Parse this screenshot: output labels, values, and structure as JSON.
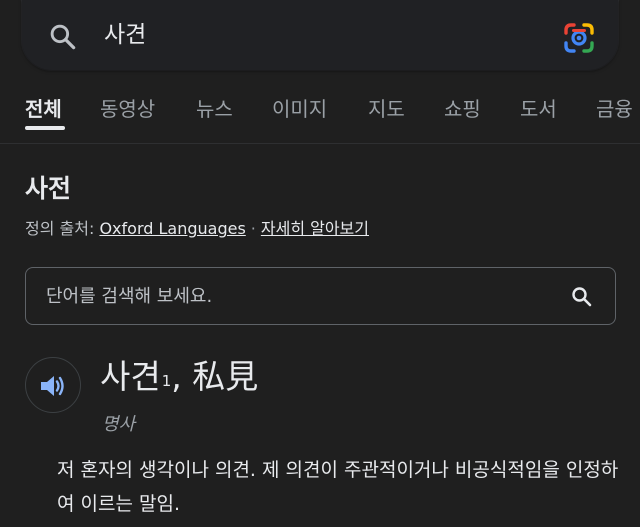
{
  "search": {
    "query": "사견"
  },
  "tabs": [
    {
      "label": "전체",
      "active": true
    },
    {
      "label": "동영상",
      "active": false
    },
    {
      "label": "뉴스",
      "active": false
    },
    {
      "label": "이미지",
      "active": false
    },
    {
      "label": "지도",
      "active": false
    },
    {
      "label": "쇼핑",
      "active": false
    },
    {
      "label": "도서",
      "active": false
    },
    {
      "label": "금융",
      "active": false
    }
  ],
  "dictionary": {
    "title": "사전",
    "source_prefix": "정의 출처:",
    "source_name": "Oxford Languages",
    "source_separator": "·",
    "learn_more": "자세히 알아보기",
    "search_placeholder": "단어를 검색해 보세요.",
    "entry": {
      "word": "사견",
      "superscript": "1",
      "hanja": ", 私見",
      "part_of_speech": "명사",
      "definition": "저 혼자의 생각이나 의견. 제 의견이 주관적이거나 비공식적임을 인정하여 이르는 말임."
    }
  },
  "colors": {
    "background": "#1f1f1f",
    "text_primary": "#e8eaed",
    "text_secondary": "#9aa0a6",
    "speaker_icon": "#8ab4f8"
  },
  "icons": {
    "search": "search-icon",
    "lens": "google-lens-icon",
    "speaker": "speaker-icon"
  }
}
